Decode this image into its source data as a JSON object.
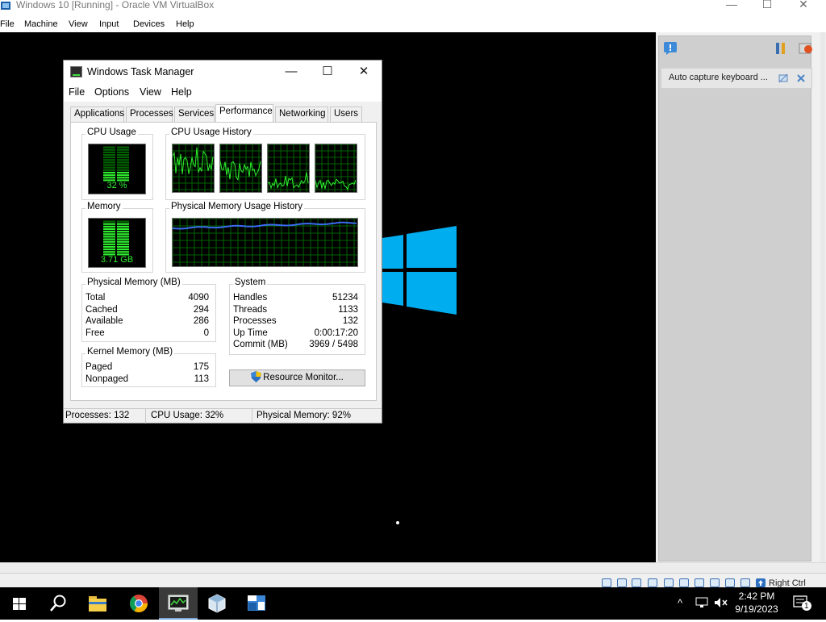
{
  "host": {
    "title": "Windows 10 [Running] - Oracle VM VirtualBox",
    "window_controls": {
      "minimize": "—",
      "maximize": "☐",
      "close": "✕"
    },
    "menu": [
      "File",
      "Machine",
      "View",
      "Input",
      "Devices",
      "Help"
    ],
    "notice": "Auto capture keyboard ...",
    "host_key": "Right Ctrl"
  },
  "taskmgr": {
    "title": "Windows Task Manager",
    "controls": {
      "minimize": "—",
      "maximize": "☐",
      "close": "✕"
    },
    "menu": [
      "File",
      "Options",
      "View",
      "Help"
    ],
    "tabs": [
      "Applications",
      "Processes",
      "Services",
      "Performance",
      "Networking",
      "Users"
    ],
    "active_tab": "Performance",
    "cpu_usage": {
      "label": "CPU Usage",
      "value": "32 %",
      "fraction": 0.32
    },
    "cpu_history": {
      "label": "CPU Usage History"
    },
    "memory": {
      "label": "Memory",
      "value": "3.71 GB",
      "fraction": 0.92
    },
    "memory_history": {
      "label": "Physical Memory Usage History"
    },
    "physical_memory": {
      "label": "Physical Memory (MB)",
      "rows": [
        {
          "name": "Total",
          "value": "4090"
        },
        {
          "name": "Cached",
          "value": "294"
        },
        {
          "name": "Available",
          "value": "286"
        },
        {
          "name": "Free",
          "value": "0"
        }
      ]
    },
    "kernel_memory": {
      "label": "Kernel Memory (MB)",
      "rows": [
        {
          "name": "Paged",
          "value": "175"
        },
        {
          "name": "Nonpaged",
          "value": "113"
        }
      ]
    },
    "system": {
      "label": "System",
      "rows": [
        {
          "name": "Handles",
          "value": "51234"
        },
        {
          "name": "Threads",
          "value": "1133"
        },
        {
          "name": "Processes",
          "value": "132"
        },
        {
          "name": "Up Time",
          "value": "0:00:17:20"
        },
        {
          "name": "Commit (MB)",
          "value": "3969 / 5498"
        }
      ]
    },
    "resource_monitor_button": "Resource Monitor...",
    "status": {
      "processes": "Processes: 132",
      "cpu": "CPU Usage: 32%",
      "memory": "Physical Memory: 92%"
    }
  },
  "taskbar": {
    "apps": [
      "start",
      "search",
      "file-explorer",
      "chrome",
      "task-manager",
      "virtualbox",
      "virtualbox-machine"
    ],
    "active_app": "task-manager",
    "time": "2:42 PM",
    "date": "9/19/2023",
    "notification_count": "1"
  },
  "colors": {
    "graph_green": "#2ef02e",
    "graph_grid": "#006400",
    "memory_line": "#3a6cf0",
    "windows_logo": "#00adef"
  }
}
